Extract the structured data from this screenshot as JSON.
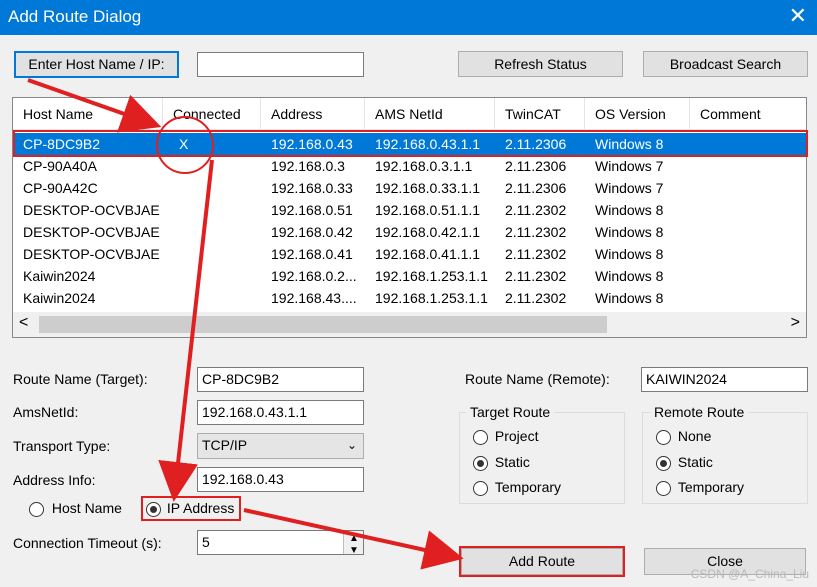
{
  "window": {
    "title": "Add Route Dialog",
    "close_icon": "close-icon"
  },
  "top": {
    "host_button": "Enter Host Name / IP:",
    "host_value": "",
    "refresh_button": "Refresh Status",
    "broadcast_button": "Broadcast Search"
  },
  "list": {
    "columns": [
      "Host Name",
      "Connected",
      "Address",
      "AMS NetId",
      "TwinCAT",
      "OS Version",
      "Comment"
    ],
    "rows": [
      {
        "host": "CP-8DC9B2",
        "connected": "X",
        "address": "192.168.0.43",
        "ams": "192.168.0.43.1.1",
        "twincat": "2.11.2306",
        "os": "Windows 8",
        "comment": ""
      },
      {
        "host": "CP-90A40A",
        "connected": "",
        "address": "192.168.0.3",
        "ams": "192.168.0.3.1.1",
        "twincat": "2.11.2306",
        "os": "Windows 7",
        "comment": ""
      },
      {
        "host": "CP-90A42C",
        "connected": "",
        "address": "192.168.0.33",
        "ams": "192.168.0.33.1.1",
        "twincat": "2.11.2306",
        "os": "Windows 7",
        "comment": ""
      },
      {
        "host": "DESKTOP-OCVBJAE",
        "connected": "",
        "address": "192.168.0.51",
        "ams": "192.168.0.51.1.1",
        "twincat": "2.11.2302",
        "os": "Windows 8",
        "comment": ""
      },
      {
        "host": "DESKTOP-OCVBJAE",
        "connected": "",
        "address": "192.168.0.42",
        "ams": "192.168.0.42.1.1",
        "twincat": "2.11.2302",
        "os": "Windows 8",
        "comment": ""
      },
      {
        "host": "DESKTOP-OCVBJAE",
        "connected": "",
        "address": "192.168.0.41",
        "ams": "192.168.0.41.1.1",
        "twincat": "2.11.2302",
        "os": "Windows 8",
        "comment": ""
      },
      {
        "host": "Kaiwin2024",
        "connected": "",
        "address": "192.168.0.2...",
        "ams": "192.168.1.253.1.1",
        "twincat": "2.11.2302",
        "os": "Windows 8",
        "comment": ""
      },
      {
        "host": "Kaiwin2024",
        "connected": "",
        "address": "192.168.43....",
        "ams": "192.168.1.253.1.1",
        "twincat": "2.11.2302",
        "os": "Windows 8",
        "comment": ""
      }
    ],
    "scroll_left": "<",
    "scroll_right": ">"
  },
  "form": {
    "route_name_target_label": "Route Name (Target):",
    "route_name_target_value": "CP-8DC9B2",
    "amsnetid_label": "AmsNetId:",
    "amsnetid_value": "192.168.0.43.1.1",
    "transport_label": "Transport Type:",
    "transport_value": "TCP/IP",
    "address_info_label": "Address Info:",
    "address_info_value": "192.168.0.43",
    "host_name_radio": "Host Name",
    "ip_address_radio": "IP Address",
    "timeout_label": "Connection Timeout (s):",
    "timeout_value": "5",
    "route_name_remote_label": "Route Name (Remote):",
    "route_name_remote_value": "KAIWIN2024"
  },
  "target_route": {
    "title": "Target Route",
    "options": [
      "Project",
      "Static",
      "Temporary"
    ],
    "selected": "Static"
  },
  "remote_route": {
    "title": "Remote Route",
    "options": [
      "None",
      "Static",
      "Temporary"
    ],
    "selected": "Static"
  },
  "actions": {
    "add_route": "Add Route",
    "close": "Close"
  },
  "watermark": "CSDN @A_China_Liu",
  "colors": {
    "titlebar": "#0078d7",
    "selection": "#0078d7",
    "annotation": "#e02020"
  }
}
